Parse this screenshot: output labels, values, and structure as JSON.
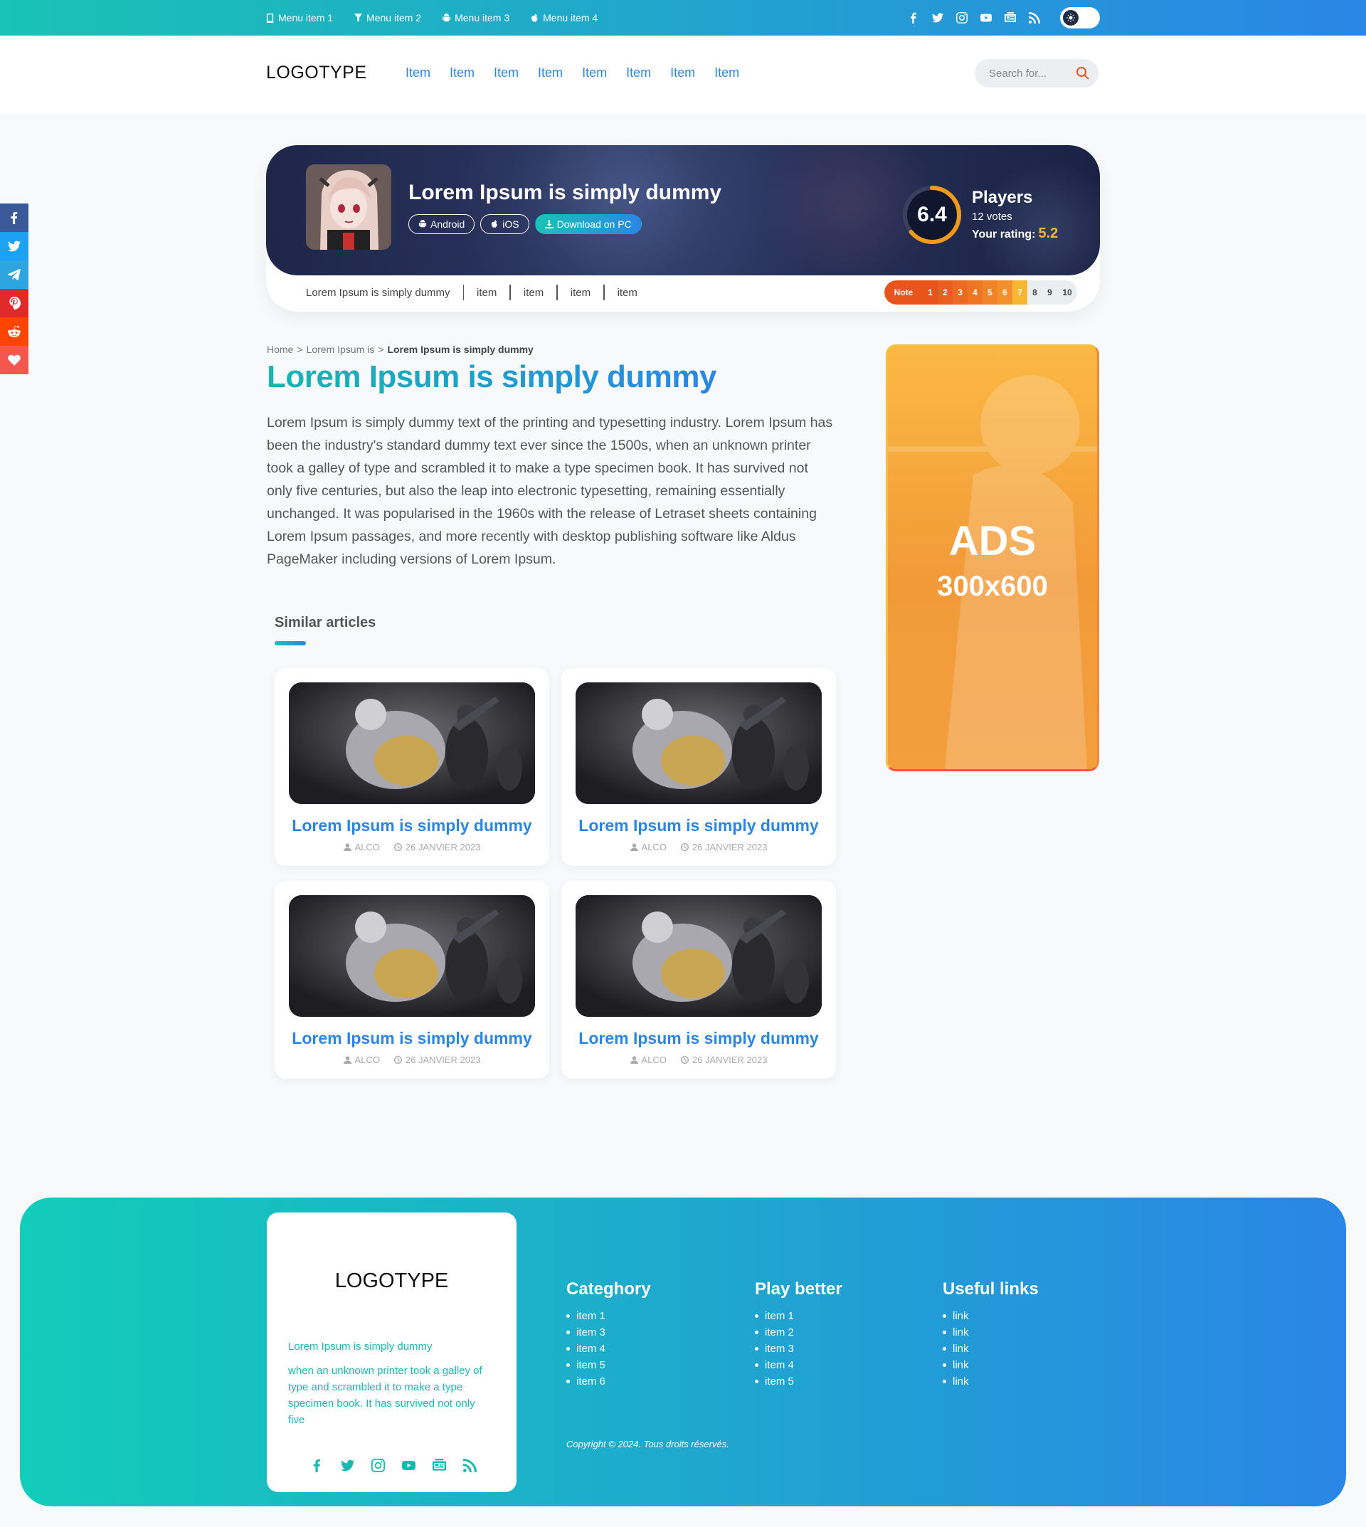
{
  "topbar": {
    "menu": [
      {
        "label": "Menu item 1",
        "icon": "mobile-icon"
      },
      {
        "label": "Menu item 2",
        "icon": "filter-icon"
      },
      {
        "label": "Menu item 3",
        "icon": "android-icon"
      },
      {
        "label": "Menu item 4",
        "icon": "apple-icon"
      }
    ],
    "social": [
      "facebook-icon",
      "twitter-icon",
      "instagram-icon",
      "youtube-icon",
      "google-news-icon",
      "rss-icon"
    ],
    "theme_toggle_icon": "sun-icon"
  },
  "header": {
    "logo": "LOGOTYPE",
    "nav": [
      "Item",
      "Item",
      "Item",
      "Item",
      "Item",
      "Item",
      "Item",
      "Item"
    ],
    "search_placeholder": "Search for..."
  },
  "share_bar": [
    {
      "icon": "facebook-icon",
      "color": "#3b5998"
    },
    {
      "icon": "twitter-icon",
      "color": "#1da1f2"
    },
    {
      "icon": "telegram-icon",
      "color": "#2ca5e0"
    },
    {
      "icon": "pinterest-icon",
      "color": "#e02a2a"
    },
    {
      "icon": "reddit-icon",
      "color": "#ff4500"
    },
    {
      "icon": "heart-icon",
      "color": "#f5564e"
    }
  ],
  "hero": {
    "title": "Lorem Ipsum is simply dummy",
    "tags": [
      {
        "label": "Android",
        "icon": "android-icon"
      },
      {
        "label": "iOS",
        "icon": "apple-icon"
      },
      {
        "label": "Download on PC",
        "icon": "download-icon"
      }
    ],
    "score": "6.4",
    "score_fraction": 0.64,
    "players_label": "Players",
    "votes": "12 votes",
    "your_rating_label": "Your rating:",
    "your_rating": "5.2",
    "sub_items": [
      "Lorem Ipsum is simply dummy",
      "item",
      "item",
      "item",
      "item"
    ],
    "note_label": "Note",
    "note_scale": [
      "1",
      "2",
      "3",
      "4",
      "5",
      "6",
      "7",
      "8",
      "9",
      "10"
    ],
    "note_selected": 7
  },
  "breadcrumb": {
    "items": [
      "Home",
      "Lorem Ipsum is",
      "Lorem Ipsum is simply dummy"
    ]
  },
  "article": {
    "title": "Lorem Ipsum is simply dummy",
    "body": "Lorem Ipsum is simply dummy text of the printing and typesetting industry. Lorem Ipsum has been the industry's standard dummy text ever since the 1500s, when an unknown printer took a galley of type and scrambled it to make a type specimen book. It has survived not only five centuries, but also the leap into electronic typesetting, remaining essentially unchanged. It was popularised in the 1960s with the release of Letraset sheets containing Lorem Ipsum passages, and more recently with desktop publishing software like Aldus PageMaker including versions of Lorem Ipsum."
  },
  "similar": {
    "heading": "Similar articles",
    "cards": [
      {
        "title": "Lorem Ipsum is simply dummy",
        "author": "ALCO",
        "date": "26 JANVIER 2023"
      },
      {
        "title": "Lorem Ipsum is simply dummy",
        "author": "ALCO",
        "date": "26 JANVIER 2023"
      },
      {
        "title": "Lorem Ipsum is simply dummy",
        "author": "ALCO",
        "date": "26 JANVIER 2023"
      },
      {
        "title": "Lorem Ipsum is simply dummy",
        "author": "ALCO",
        "date": "26 JANVIER 2023"
      }
    ]
  },
  "ads": {
    "line1": "ADS",
    "line2": "300x600"
  },
  "footer": {
    "logo": "LOGOTYPE",
    "tagline": "Lorem Ipsum is simply dummy",
    "description": "when an unknown printer took a galley of type and scrambled it to make a type specimen book. It has survived not only five",
    "social": [
      "facebook-icon",
      "twitter-icon",
      "instagram-icon",
      "youtube-icon",
      "google-news-icon",
      "rss-icon"
    ],
    "columns": [
      {
        "title": "Categhory",
        "items": [
          "item 1",
          "item 3",
          "item 4",
          "item 5",
          "item 6"
        ]
      },
      {
        "title": "Play better",
        "items": [
          "item 1",
          "item 2",
          "item 3",
          "item 4",
          "item 5"
        ]
      },
      {
        "title": "Useful links",
        "items": [
          "link",
          "link",
          "link",
          "link",
          "link"
        ]
      }
    ],
    "copyright": "Copyright © 2024. Tous droits réservés."
  },
  "colors": {
    "accent_teal": "#19c3b5",
    "accent_blue": "#2a86e6",
    "accent_orange": "#e8541c",
    "rating_yellow": "#f7b733"
  }
}
